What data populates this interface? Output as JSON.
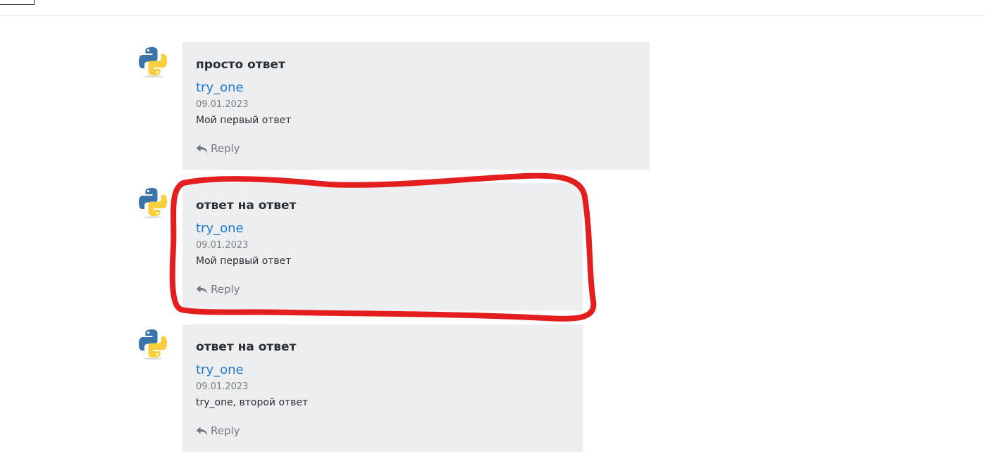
{
  "comments": [
    {
      "title": "просто ответ",
      "author": "try_one",
      "date": "09.01.2023",
      "text": "Мой первый ответ",
      "reply_label": "Reply"
    },
    {
      "title": "ответ на ответ",
      "author": "try_one",
      "date": "09.01.2023",
      "text": "Мой первый ответ",
      "reply_label": "Reply"
    },
    {
      "title": "ответ на ответ",
      "author": "try_one",
      "date": "09.01.2023",
      "text": "try_one, второй ответ",
      "reply_label": "Reply"
    }
  ],
  "icons": {
    "avatar": "python-logo-icon",
    "reply": "reply-arrow-icon"
  },
  "colors": {
    "card_bg": "#eceeef",
    "author_link": "#1f7ad1",
    "highlight": "#e41e1e"
  }
}
